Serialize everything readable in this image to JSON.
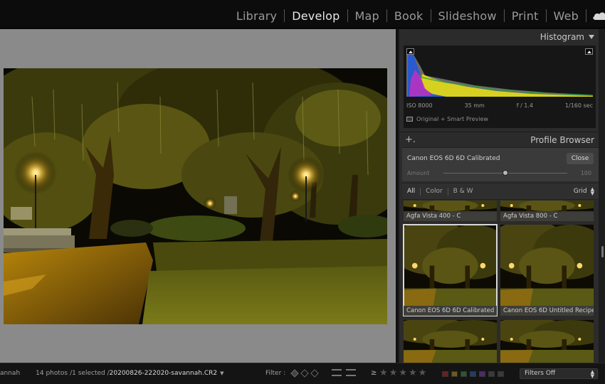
{
  "modules": [
    {
      "label": "Library",
      "active": false
    },
    {
      "label": "Develop",
      "active": true
    },
    {
      "label": "Map",
      "active": false
    },
    {
      "label": "Book",
      "active": false
    },
    {
      "label": "Slideshow",
      "active": false
    },
    {
      "label": "Print",
      "active": false
    },
    {
      "label": "Web",
      "active": false
    }
  ],
  "histogram": {
    "title": "Histogram",
    "iso": "ISO 8000",
    "focal": "35 mm",
    "aperture": "f / 1.4",
    "shutter": "1/160 sec",
    "preview": "Original + Smart Preview"
  },
  "profile_browser": {
    "title": "Profile Browser",
    "plus": "+.",
    "current": "Canon EOS 6D 6D Calibrated",
    "close": "Close",
    "amount_label": "Amount",
    "amount_value": "100",
    "amount_fraction": 0.5,
    "filters": [
      {
        "label": "All",
        "active": true
      },
      {
        "label": "Color",
        "active": false
      },
      {
        "label": "B & W",
        "active": false
      }
    ],
    "view": "Grid",
    "tiles": [
      {
        "caption": "Agfa Vista 400 - C",
        "selected": false
      },
      {
        "caption": "Agfa Vista 800 - C",
        "selected": false
      },
      {
        "caption": "Canon EOS 6D 6D Calibrated",
        "selected": true
      },
      {
        "caption": "Canon EOS 6D Untitled Recipe",
        "selected": false
      },
      {
        "caption": "",
        "selected": false
      },
      {
        "caption": "",
        "selected": false
      }
    ]
  },
  "filmstrip": {
    "source_cut": "annah",
    "count": "14 photos",
    "selected": "/1 selected /",
    "filename": "20200826-222020-savannah.CR2",
    "filter_label": "Filter :",
    "gte": "≥",
    "stars": "★★★★★",
    "filters_off": "Filters Off",
    "label_colors": [
      "#6b1f1f",
      "#6b5a1f",
      "#2a5a2a",
      "#1f3e6b",
      "#4d2a6b",
      "#3a3a3a",
      "#3a3a3a"
    ]
  }
}
